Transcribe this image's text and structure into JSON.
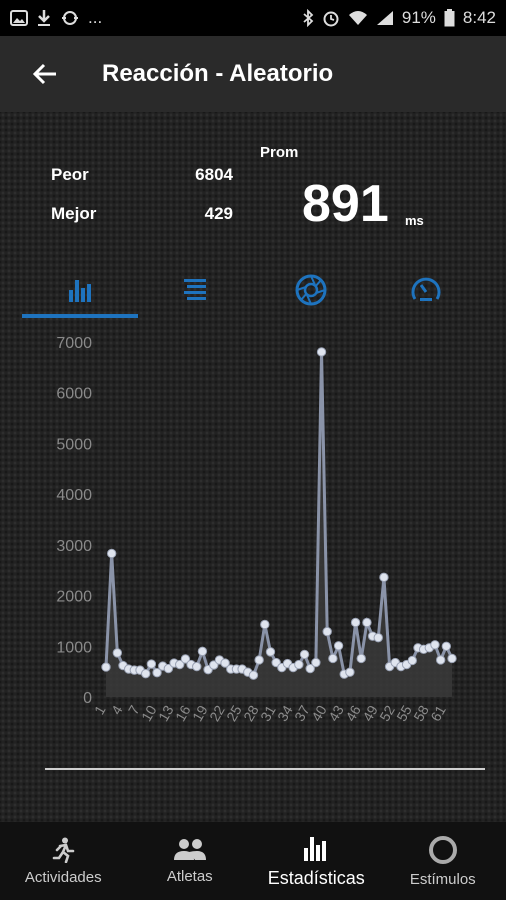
{
  "status_bar": {
    "battery": "91%",
    "time": "8:42",
    "overflow": "..."
  },
  "header": {
    "title": "Reacción - Aleatorio",
    "back_icon": "arrow-left-icon"
  },
  "stats": {
    "worst_label": "Peor",
    "worst_value": "6804",
    "best_label": "Mejor",
    "best_value": "429",
    "avg_label": "Prom",
    "avg_value": "891",
    "avg_unit": "ms"
  },
  "tabs": [
    {
      "icon": "bar-chart-icon",
      "active": true
    },
    {
      "icon": "list-icon",
      "active": false
    },
    {
      "icon": "aperture-icon",
      "active": false
    },
    {
      "icon": "gauge-icon",
      "active": false
    }
  ],
  "chart_data": {
    "type": "line",
    "title": "",
    "xlabel": "",
    "ylabel": "",
    "ylim": [
      0,
      7000
    ],
    "y_ticks": [
      0,
      1000,
      2000,
      3000,
      4000,
      5000,
      6000,
      7000
    ],
    "x_tick_labels": [
      "1",
      "4",
      "7",
      "10",
      "13",
      "16",
      "19",
      "22",
      "25",
      "28",
      "31",
      "34",
      "37",
      "40",
      "43",
      "46",
      "49",
      "52",
      "55",
      "58",
      "61"
    ],
    "x": [
      1,
      2,
      3,
      4,
      5,
      6,
      7,
      8,
      9,
      10,
      11,
      12,
      13,
      14,
      15,
      16,
      17,
      18,
      19,
      20,
      21,
      22,
      23,
      24,
      25,
      26,
      27,
      28,
      29,
      30,
      31,
      32,
      33,
      34,
      35,
      36,
      37,
      38,
      39,
      40,
      41,
      42,
      43,
      44,
      45,
      46,
      47,
      48,
      49,
      50,
      51,
      52,
      53,
      54,
      55,
      56,
      57,
      58,
      59,
      60,
      61,
      62
    ],
    "y": [
      590,
      2830,
      870,
      620,
      550,
      530,
      530,
      460,
      650,
      480,
      610,
      560,
      670,
      640,
      750,
      640,
      600,
      900,
      540,
      630,
      730,
      670,
      550,
      550,
      550,
      490,
      430,
      730,
      1430,
      890,
      680,
      580,
      660,
      580,
      640,
      840,
      560,
      680,
      6804,
      1290,
      760,
      1010,
      450,
      490,
      1470,
      760,
      1470,
      1200,
      1170,
      2360,
      600,
      680,
      600,
      640,
      720,
      970,
      940,
      970,
      1030,
      730,
      1000,
      760
    ],
    "series": [
      {
        "values_ref": "y"
      }
    ],
    "colors": {
      "line": "#8a93a8",
      "marker": "#dfe4ee",
      "fill": "#3a3a3a"
    },
    "grid": false
  },
  "bottom_nav": [
    {
      "label": "Actividades",
      "icon": "running-person-icon",
      "active": false
    },
    {
      "label": "Atletas",
      "icon": "people-icon",
      "active": false
    },
    {
      "label": "Estadísticas",
      "icon": "bar-chart-icon",
      "active": true
    },
    {
      "label": "Estímulos",
      "icon": "circle-ring-icon",
      "active": false
    }
  ],
  "colors": {
    "accent": "#1e73be",
    "background": "#1e1e1e",
    "app_bar": "#2a2a2a"
  }
}
